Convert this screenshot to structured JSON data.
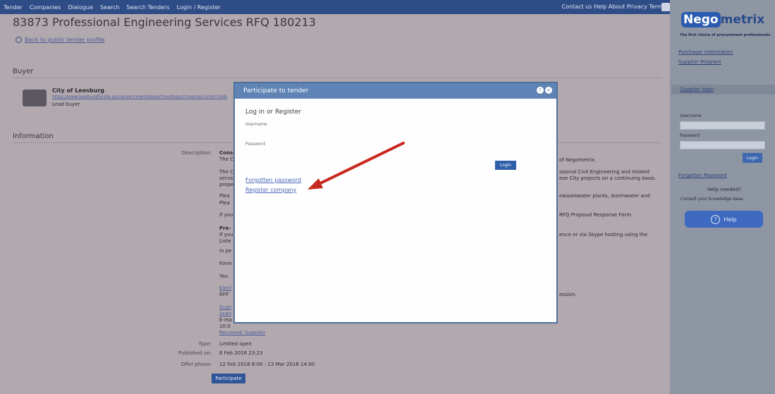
{
  "topnav": {
    "items": [
      "Tender",
      "Companies",
      "Dialogue",
      "Search",
      "Search Tenders",
      "Login / Register"
    ],
    "right_text": "Contact us   Help   About   Privacy   Terms"
  },
  "page": {
    "title": "83873 Professional Engineering Services RFQ 180213",
    "back_link": "Back to public tender profile",
    "buyer_heading": "Buyer",
    "buyer_name": "City of Leesburg",
    "buyer_url": "https://www.leesburgflorida.gov/government/departments/purchasing/current-bids",
    "buyer_role": "Lead buyer",
    "info_heading": "Information",
    "description_label": "Description:",
    "desc_fragments": [
      "Conso",
      "The C",
      "The C",
      "servic",
      "prope",
      "Plea",
      "Plea",
      "If you",
      "Pre-",
      "If you",
      "Liste",
      "In pe",
      "Form",
      "You",
      "Elect",
      "RFP",
      "Scan",
      "Scan",
      "E-ma",
      "10:0"
    ],
    "right_fragments": [
      "of Negometrix.",
      "ssional Civil Engineering and related",
      "ese City projects on a continuing basis.",
      "ewastewater plants, stormwater and",
      "RFQ Proposal Response Form.",
      "ence or via Skype hosting using the",
      "ession.",
      "Received: Supplier"
    ],
    "type_label": "Type:",
    "type_value": "Limited open",
    "published_label": "Published on:",
    "published_value": "6 Feb 2018 23:23",
    "period_label": "Offer phase:",
    "period_value": "12 Feb 2018 8:00 - 13 Mar 2018 14:00",
    "bottom_button": "Participate"
  },
  "sidebar": {
    "brand_box": "Nego",
    "brand_rest": "metrix",
    "tagline": "The first choice of procurement professionals",
    "links": [
      "Purchaser information",
      "Supplier Program"
    ],
    "section_bar": "Supplier login",
    "username_label": "Username",
    "password_label": "Password",
    "login_button": "Login",
    "forgot_link": "Forgotten Password",
    "help_question": "Help needed?",
    "help_desc": "Consult your knowledge base",
    "help_button": "Help"
  },
  "modal": {
    "title": "Participate to tender",
    "heading": "Log in or Register",
    "username_label": "Username",
    "password_label": "Password",
    "login_button": "Login",
    "forgot_link": "Forgotten password",
    "register_link": "Register company",
    "help_icon_glyph": "?",
    "close_icon_glyph": "×"
  },
  "colors": {
    "modal_header": "#5e83b4",
    "arrow": "#c8281e",
    "nav_bar": "#2e4c86",
    "brand": "#2a5bb0"
  }
}
